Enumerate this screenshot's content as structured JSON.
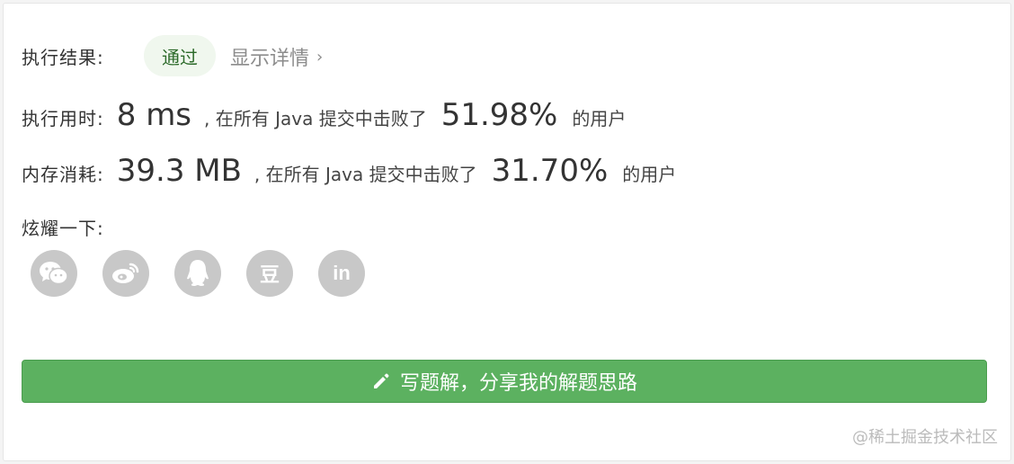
{
  "result": {
    "label": "执行结果:",
    "status": "通过",
    "detail_link": "显示详情",
    "detail_chevron": "›"
  },
  "runtime": {
    "label": "执行用时:",
    "value": "8 ms",
    "prefix": ", 在所有 Java 提交中击败了",
    "percent": "51.98%",
    "suffix": "的用户"
  },
  "memory": {
    "label": "内存消耗:",
    "value": "39.3 MB",
    "prefix": ", 在所有 Java 提交中击败了",
    "percent": "31.70%",
    "suffix": "的用户"
  },
  "share": {
    "label": "炫耀一下:",
    "icons": [
      "wechat-icon",
      "weibo-icon",
      "qq-icon",
      "douban-icon",
      "linkedin-icon"
    ],
    "douban_glyph": "豆",
    "linkedin_glyph": "in"
  },
  "write_button": {
    "label": "写题解，分享我的解题思路",
    "icon": "pencil-icon"
  },
  "watermark": "@稀土掘金技术社区",
  "colors": {
    "accent_green": "#5cb160",
    "badge_bg": "#f0f7ee",
    "icon_gray": "#c8c8c8"
  }
}
